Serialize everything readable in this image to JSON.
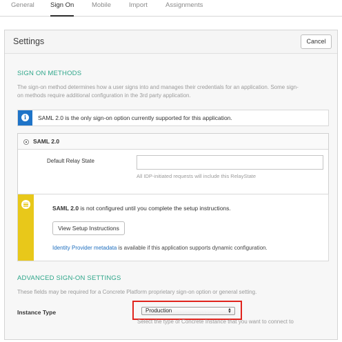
{
  "tabs": [
    {
      "label": "General"
    },
    {
      "label": "Sign On"
    },
    {
      "label": "Mobile"
    },
    {
      "label": "Import"
    },
    {
      "label": "Assignments"
    }
  ],
  "panel": {
    "title": "Settings",
    "cancel_label": "Cancel"
  },
  "sign_on_methods": {
    "heading": "SIGN ON METHODS",
    "description_line1": "The sign-on method determines how a user signs into and manages their credentials for an application. Some sign-",
    "description_line2": "on methods require additional configuration in the 3rd party application.",
    "info_icon": "info-icon",
    "info_text": "SAML 2.0 is the only sign-on option currently supported for this application."
  },
  "saml": {
    "option_label": "SAML 2.0",
    "relay_label": "Default Relay State",
    "relay_value": "",
    "relay_hint": "All IDP-initiated requests will include this RelayState"
  },
  "setup_notice": {
    "icon": "list-icon",
    "bold_text": "SAML 2.0",
    "text": " is not configured until you complete the setup instructions.",
    "button_label": "View Setup Instructions",
    "link_text": "Identity Provider metadata",
    "foot_text": " is available if this application supports dynamic configuration."
  },
  "advanced": {
    "heading": "ADVANCED SIGN-ON SETTINGS",
    "description": "These fields may be required for a Concrete Platform proprietary sign-on option or general setting.",
    "instance_label": "Instance Type",
    "instance_value": "Production",
    "instance_hint": "Select the type of Concrete Instance that you want to connect to"
  },
  "colors": {
    "accent": "#2ea68a",
    "info": "#1f74c8",
    "warning": "#e8c81a",
    "highlight": "#e0231c"
  }
}
